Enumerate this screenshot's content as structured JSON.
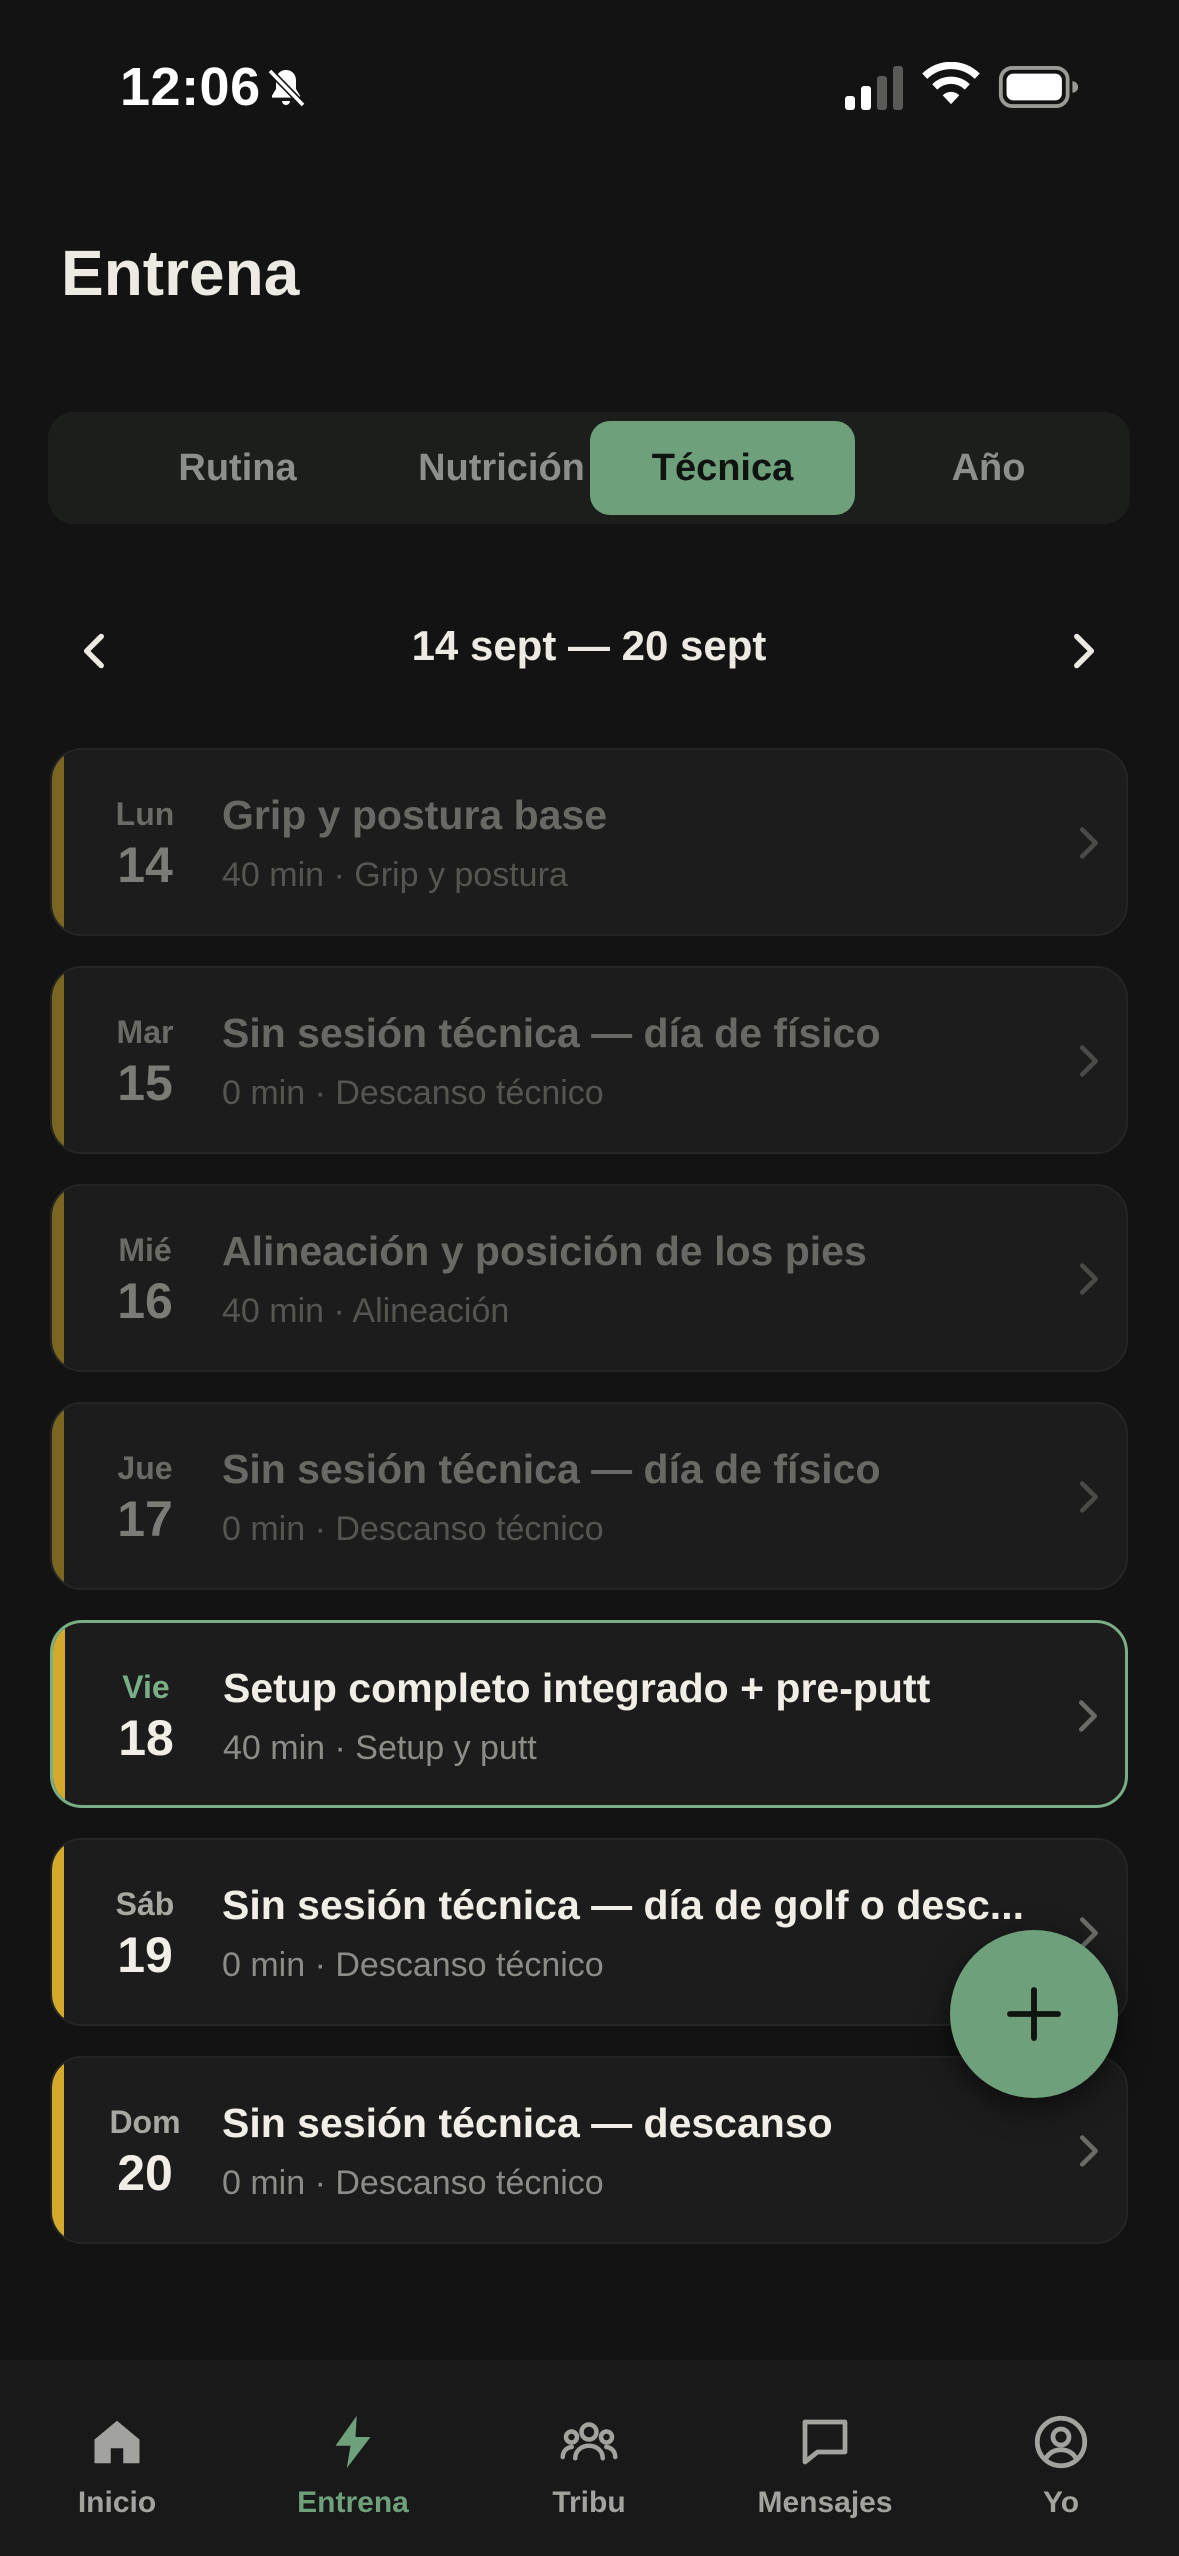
{
  "status_bar": {
    "time": "12:06",
    "icons": [
      "bell-off-icon",
      "cellular-signal-icon",
      "wifi-icon",
      "battery-icon"
    ]
  },
  "page": {
    "title": "Entrena"
  },
  "segments": [
    {
      "label": "Rutina",
      "active": false
    },
    {
      "label": "Nutrición",
      "active": false
    },
    {
      "label": "Técnica",
      "active": true
    },
    {
      "label": "Año",
      "active": false
    }
  ],
  "week": {
    "label": "14 sept — 20 sept",
    "prev_icon": "chevron-left-icon",
    "next_icon": "chevron-right-icon"
  },
  "days": [
    {
      "abbr": "Lun",
      "num": "14",
      "title": "Grip y postura base",
      "subtitle": "40 min · Grip y postura",
      "state": "past"
    },
    {
      "abbr": "Mar",
      "num": "15",
      "title": "Sin sesión técnica — día de físico",
      "subtitle": "0 min · Descanso técnico",
      "state": "past"
    },
    {
      "abbr": "Mié",
      "num": "16",
      "title": "Alineación y posición de los pies",
      "subtitle": "40 min · Alineación",
      "state": "past"
    },
    {
      "abbr": "Jue",
      "num": "17",
      "title": "Sin sesión técnica — día de físico",
      "subtitle": "0 min · Descanso técnico",
      "state": "past"
    },
    {
      "abbr": "Vie",
      "num": "18",
      "title": "Setup completo integrado + pre-putt",
      "subtitle": "40 min · Setup y putt",
      "state": "today"
    },
    {
      "abbr": "Sáb",
      "num": "19",
      "title": "Sin sesión técnica — día de golf o desc...",
      "subtitle": "0 min · Descanso técnico",
      "state": "upcoming"
    },
    {
      "abbr": "Dom",
      "num": "20",
      "title": "Sin sesión técnica — descanso",
      "subtitle": "0 min · Descanso técnico",
      "state": "upcoming"
    }
  ],
  "fab": {
    "icon": "plus-icon"
  },
  "tab_bar": [
    {
      "label": "Inicio",
      "icon": "home-icon",
      "active": false
    },
    {
      "label": "Entrena",
      "icon": "lightning-bolt-icon",
      "active": true
    },
    {
      "label": "Tribu",
      "icon": "group-icon",
      "active": false
    },
    {
      "label": "Mensajes",
      "icon": "chat-bubble-icon",
      "active": false
    },
    {
      "label": "Yo",
      "icon": "user-circle-icon",
      "active": false
    }
  ],
  "colors": {
    "background": "#121312",
    "accent_green": "#6fa07c",
    "accent_gold": "#d4aa2c",
    "card_bg": "#1b1c1b"
  }
}
